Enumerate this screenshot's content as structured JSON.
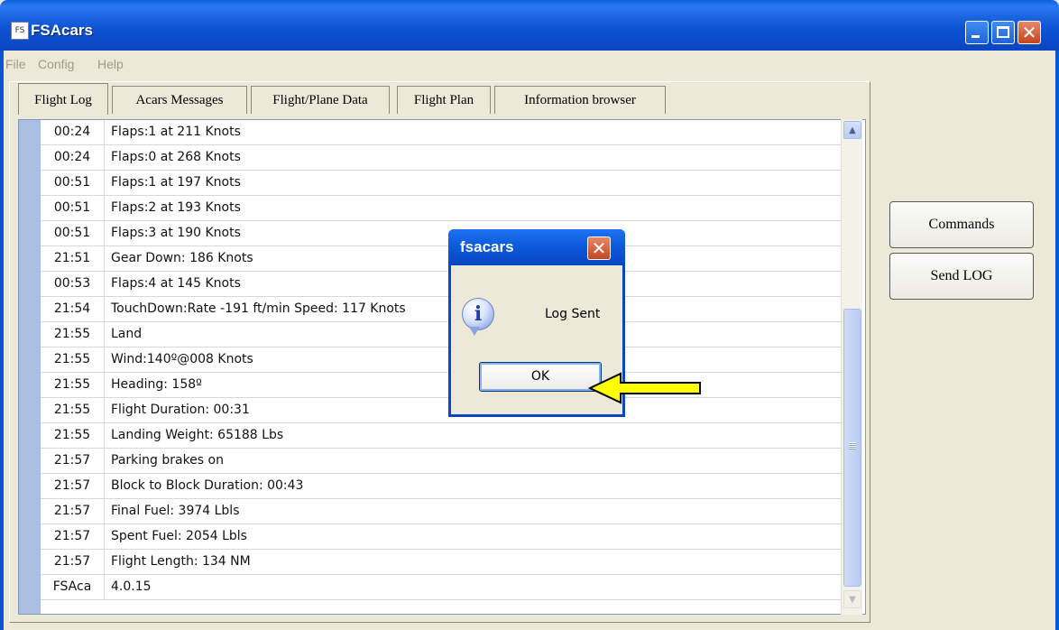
{
  "window": {
    "title": "FSAcars",
    "icon_label": "FS"
  },
  "menu": [
    "File",
    "Config",
    "Help"
  ],
  "tabs": [
    "Flight Log",
    "Acars Messages",
    "Flight/Plane Data",
    "Flight Plan",
    "Information browser"
  ],
  "log": [
    {
      "time": "00:24",
      "msg": "Flaps:1 at 211 Knots"
    },
    {
      "time": "00:24",
      "msg": "Flaps:0 at 268 Knots"
    },
    {
      "time": "00:51",
      "msg": "Flaps:1 at 197 Knots"
    },
    {
      "time": "00:51",
      "msg": "Flaps:2 at 193 Knots"
    },
    {
      "time": "00:51",
      "msg": "Flaps:3 at 190 Knots"
    },
    {
      "time": "21:51",
      "msg": "Gear Down: 186 Knots"
    },
    {
      "time": "00:53",
      "msg": "Flaps:4 at 145 Knots"
    },
    {
      "time": "21:54",
      "msg": "TouchDown:Rate -191 ft/min Speed: 117 Knots"
    },
    {
      "time": "21:55",
      "msg": "Land"
    },
    {
      "time": "21:55",
      "msg": "Wind:140º@008 Knots"
    },
    {
      "time": "21:55",
      "msg": "Heading: 158º"
    },
    {
      "time": "21:55",
      "msg": "Flight Duration: 00:31"
    },
    {
      "time": "21:55",
      "msg": "Landing Weight: 65188 Lbs"
    },
    {
      "time": "21:57",
      "msg": "Parking brakes on"
    },
    {
      "time": "21:57",
      "msg": "Block to Block Duration: 00:43"
    },
    {
      "time": "21:57",
      "msg": "Final Fuel: 3974 Lbls"
    },
    {
      "time": "21:57",
      "msg": "Spent Fuel: 2054 Lbls"
    },
    {
      "time": "21:57",
      "msg": "Flight Length: 134 NM"
    },
    {
      "time": "FSAca",
      "msg": "4.0.15"
    }
  ],
  "buttons": {
    "commands": "Commands",
    "send_log": "Send LOG"
  },
  "dialog": {
    "title": "fsacars",
    "message": "Log Sent",
    "ok": "OK",
    "close_glyph": "✕",
    "icon_glyph": "i"
  },
  "colors": {
    "titlebar": "#0d54d4",
    "arrow": "#ffff00"
  }
}
